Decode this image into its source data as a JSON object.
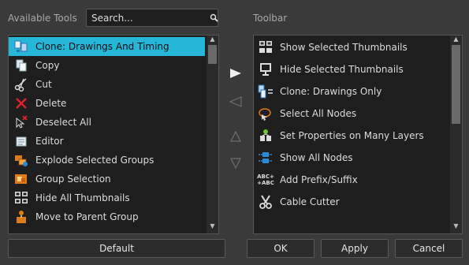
{
  "available_tools": {
    "label": "Available Tools",
    "search_placeholder": "Search...",
    "items": [
      {
        "label": "Clone: Drawings And Timing",
        "icon": "clone-drawings-timing-icon",
        "selected": true
      },
      {
        "label": "Copy",
        "icon": "copy-icon"
      },
      {
        "label": "Cut",
        "icon": "scissors-icon"
      },
      {
        "label": "Delete",
        "icon": "delete-x-icon"
      },
      {
        "label": "Deselect All",
        "icon": "deselect-all-icon"
      },
      {
        "label": "Editor",
        "icon": "editor-icon"
      },
      {
        "label": "Explode Selected Groups",
        "icon": "explode-groups-icon"
      },
      {
        "label": "Group Selection",
        "icon": "group-selection-icon"
      },
      {
        "label": "Hide All Thumbnails",
        "icon": "hide-all-thumbnails-icon"
      },
      {
        "label": "Move to Parent Group",
        "icon": "move-to-parent-group-icon"
      }
    ]
  },
  "toolbar": {
    "label": "Toolbar",
    "items": [
      {
        "label": "Show Selected Thumbnails",
        "icon": "show-thumbnails-icon"
      },
      {
        "label": "Hide Selected Thumbnails",
        "icon": "hide-thumbnails-icon"
      },
      {
        "label": "Clone: Drawings Only",
        "icon": "clone-drawings-only-icon"
      },
      {
        "label": "Select All Nodes",
        "icon": "select-all-nodes-icon"
      },
      {
        "label": "Set Properties on Many Layers",
        "icon": "set-properties-icon"
      },
      {
        "label": "Show All Nodes",
        "icon": "show-all-nodes-icon"
      },
      {
        "label": "Add Prefix/Suffix",
        "icon": "add-prefix-suffix-icon",
        "icon_text": "ABC+\n+ABC"
      },
      {
        "label": "Cable Cutter",
        "icon": "cable-cutter-icon"
      }
    ]
  },
  "buttons": {
    "default": "Default",
    "ok": "OK",
    "apply": "Apply",
    "cancel": "Cancel"
  },
  "colors": {
    "selection": "#26b6d8",
    "background": "#3a3a3a",
    "list_bg": "#1e1e1e"
  }
}
